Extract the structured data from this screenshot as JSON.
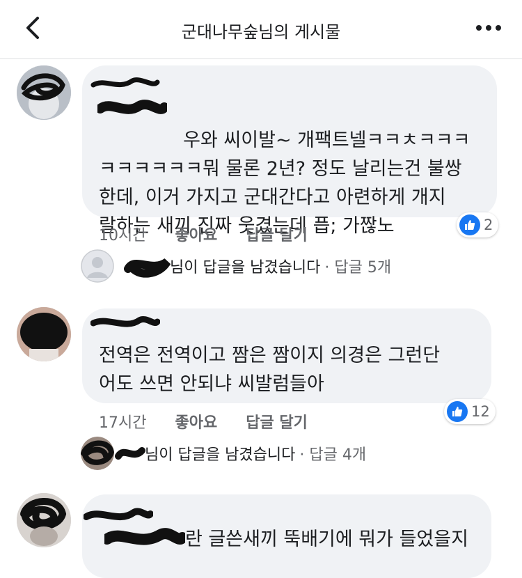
{
  "header": {
    "title": "군대나무숲님의 게시물"
  },
  "comments": [
    {
      "text": "우와 씨이발~ 개팩트넬ㅋㅋㅊㅋㅋㅋ\nㅋㅋㅋㅋㅋㅋ뭐 물론 2년? 정도 날리는건 불쌍\n한데, 이거 가지고 군대간다고 아련하게 개지\n랄하는 새끼 진짜 웃겼는데 픕; 가짢노",
      "time": "10시간",
      "like_label": "좋아요",
      "reply_label": "답글 달기",
      "reactions": "2",
      "reply_summary": "님이 답글을 남겼습니다",
      "reply_count": "· 답글 5개"
    },
    {
      "text": "전역은 전역이고 짬은 짬이지 의경은 그런단\n어도 쓰면 안되냐 씨발럼들아",
      "time": "17시간",
      "like_label": "좋아요",
      "reply_label": "답글 달기",
      "reactions": "12",
      "reply_summary": "님이 답글을 남겼습니다",
      "reply_count": "· 답글 4개"
    },
    {
      "text": "란 글쓴새끼 뚝배기에 뭐가 들었을지"
    }
  ],
  "colors": {
    "link_blue": "#1877f2",
    "bubble": "#f0f2f5",
    "meta_gray": "#65676b"
  }
}
